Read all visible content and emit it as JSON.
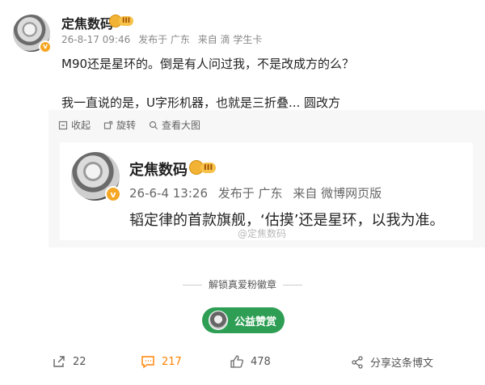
{
  "post": {
    "author": "定焦数码",
    "level_badge": "III",
    "verify_mark": "v",
    "meta": [
      "26-8-17 09:46",
      "发布于 广东",
      "来自 滴 学生卡"
    ],
    "text_line1": "M90还是星环的。倒是有人问过我，不是改成方的么？",
    "text_line2": "我一直说的是，U字形机器，也就是三折叠... 圆改方"
  },
  "toolbar": {
    "collect": "收起",
    "rotate": "旋转",
    "view_large": "查看大图"
  },
  "embedded": {
    "author": "定焦数码",
    "level_badge": "III",
    "verify_mark": "v",
    "meta": [
      "26-6-4 13:26",
      "发布于 广东",
      "来自 微博网页版"
    ],
    "text": "韬定律的首款旗舰，‘估摸’还是星环，以我为准。",
    "watermark": "@定焦数码"
  },
  "badge_section": {
    "unlock_text": "解锁真爱粉徽章",
    "donate_label": "公益赞赏"
  },
  "footer": {
    "repost_count": "22",
    "comment_count": "217",
    "like_count": "478",
    "share_label": "分享这条博文"
  },
  "colors": {
    "accent_orange": "#ff8200",
    "donate_green": "#2f9e55",
    "verify_orange": "#f5a623"
  }
}
